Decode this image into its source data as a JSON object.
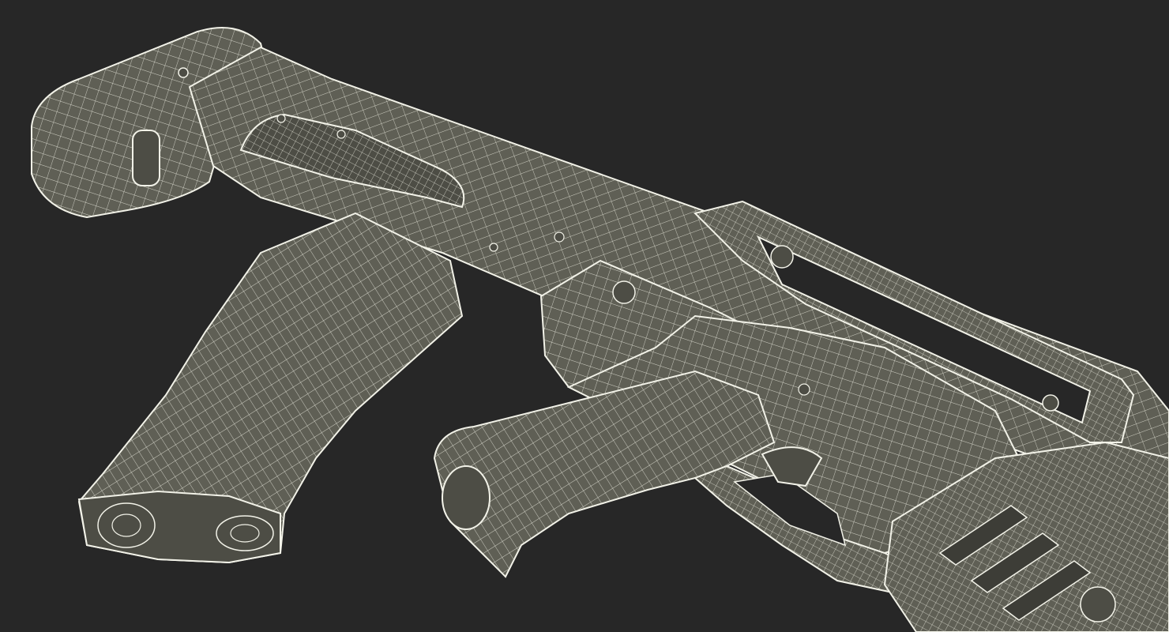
{
  "scene": {
    "subject": "wireframe-rifle-render",
    "background_color": "#272727",
    "mesh_fill_color": "#5f5f55",
    "mesh_shade_color": "#4d4d45",
    "wire_color": "#e8e8dc",
    "edge_color": "#f2f2e8"
  }
}
